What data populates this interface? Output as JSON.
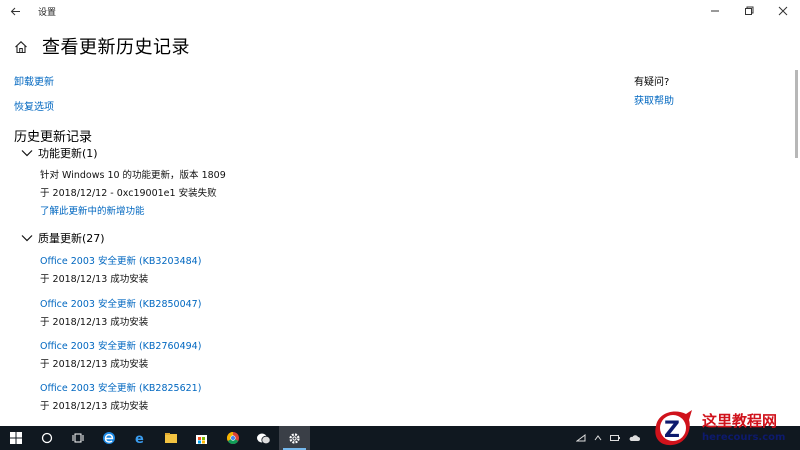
{
  "titlebar": {
    "title": "设置"
  },
  "header": {
    "title": "查看更新历史记录"
  },
  "links": {
    "uninstall": "卸载更新",
    "recovery": "恢复选项"
  },
  "history_title": "历史更新记录",
  "feature_updates": {
    "label": "功能更新(1)",
    "items": [
      {
        "name": "针对 Windows 10 的功能更新，版本 1809",
        "status": "于 2018/12/12 - 0xc19001e1 安装失败",
        "link": "了解此更新中的新增功能"
      }
    ]
  },
  "quality_updates": {
    "label": "质量更新(27)",
    "items": [
      {
        "name": "Office 2003 安全更新 (KB3203484)",
        "status": "于 2018/12/13 成功安装"
      },
      {
        "name": "Office 2003 安全更新 (KB2850047)",
        "status": "于 2018/12/13 成功安装"
      },
      {
        "name": "Office 2003 安全更新 (KB2760494)",
        "status": "于 2018/12/13 成功安装"
      },
      {
        "name": "Office 2003 安全更新 (KB2825621)",
        "status": "于 2018/12/13 成功安装"
      }
    ]
  },
  "help": {
    "question": "有疑问?",
    "link": "获取帮助"
  },
  "watermark": {
    "title": "这里教程网",
    "subtitle": "herecours.com"
  }
}
